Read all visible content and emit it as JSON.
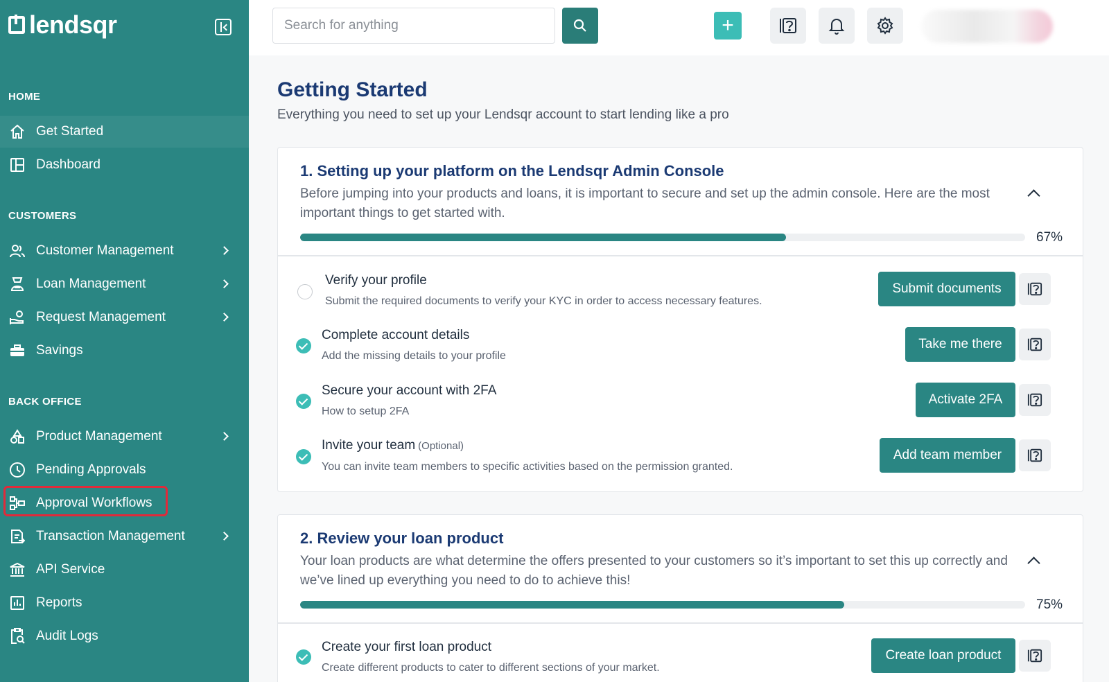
{
  "app": {
    "logo_text": "lendsqr"
  },
  "sidebar": {
    "sections": [
      {
        "title": "HOME"
      },
      {
        "title": "CUSTOMERS"
      },
      {
        "title": "BACK OFFICE"
      }
    ],
    "items": [
      {
        "label": "Get Started",
        "icon": "home-icon"
      },
      {
        "label": "Dashboard",
        "icon": "dashboard-icon"
      },
      {
        "label": "Customer Management",
        "icon": "users-icon"
      },
      {
        "label": "Loan Management",
        "icon": "loan-icon"
      },
      {
        "label": "Request Management",
        "icon": "request-icon"
      },
      {
        "label": "Savings",
        "icon": "briefcase-icon"
      },
      {
        "label": "Product Management",
        "icon": "shapes-icon"
      },
      {
        "label": "Pending Approvals",
        "icon": "clock-icon"
      },
      {
        "label": "Approval Workflows",
        "icon": "workflow-icon"
      },
      {
        "label": "Transaction Management",
        "icon": "transaction-icon"
      },
      {
        "label": "API Service",
        "icon": "bank-icon"
      },
      {
        "label": "Reports",
        "icon": "chart-icon"
      },
      {
        "label": "Audit Logs",
        "icon": "audit-icon"
      }
    ]
  },
  "topbar": {
    "search_placeholder": "Search for anything",
    "plus_label": "+"
  },
  "main": {
    "title": "Getting Started",
    "subtitle": "Everything you need to set up your Lendsqr account to start lending like a pro",
    "cards": [
      {
        "title": "1. Setting up your platform on the Lendsqr Admin Console",
        "description": "Before jumping into your products and loans, it is important to secure and set up the admin console. Here are the most important things to get started with.",
        "progress": 67,
        "progress_label": "67%",
        "tasks": [
          {
            "title": "Verify your profile",
            "optional": "",
            "description": "Submit the required documents to verify your KYC in order to access necessary features.",
            "button": "Submit documents",
            "done": false
          },
          {
            "title": "Complete account details",
            "optional": "",
            "description": "Add the missing details to your profile",
            "button": "Take me there",
            "done": true
          },
          {
            "title": "Secure your account with 2FA",
            "optional": "",
            "description": "How to setup 2FA",
            "button": "Activate 2FA",
            "done": true
          },
          {
            "title": "Invite your team",
            "optional": "(Optional)",
            "description": "You can invite team members to specific activities based on the permission granted.",
            "button": "Add team member",
            "done": true
          }
        ]
      },
      {
        "title": "2. Review your loan product",
        "description": "Your loan products are what determine the offers presented to your customers so it’s important to set this up correctly and we’ve lined up everything you need to do to achieve this!",
        "progress": 75,
        "progress_label": "75%",
        "tasks": [
          {
            "title": "Create your first loan product",
            "optional": "",
            "description": "Create different products to cater to different sections of your market.",
            "button": "Create loan product",
            "done": true
          }
        ]
      }
    ]
  },
  "colors": {
    "sidebar_bg": "#2a8683",
    "accent": "#2a8683",
    "heading": "#1b3a73",
    "check": "#3cbdb6",
    "highlight": "#e02a3a"
  }
}
